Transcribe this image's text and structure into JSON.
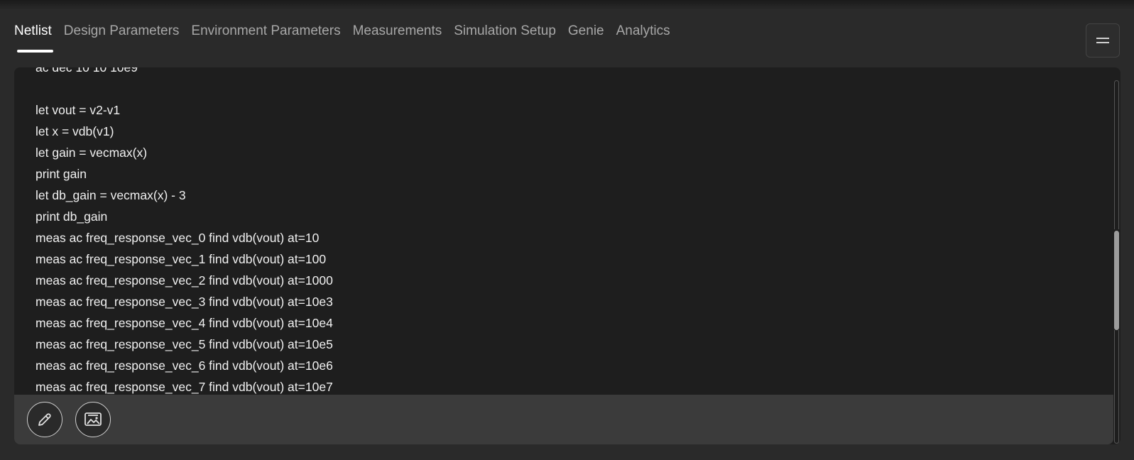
{
  "tabs": [
    {
      "label": "Netlist",
      "active": true
    },
    {
      "label": "Design Parameters"
    },
    {
      "label": "Environment Parameters"
    },
    {
      "label": "Measurements"
    },
    {
      "label": "Simulation Setup"
    },
    {
      "label": "Genie"
    },
    {
      "label": "Analytics"
    }
  ],
  "menu": {
    "icon": "hamburger-menu-icon"
  },
  "editor": {
    "lines": [
      "ac dec 10 10 10e9",
      "",
      "let vout = v2-v1",
      "let x = vdb(v1)",
      "let gain = vecmax(x)",
      "print gain",
      "let db_gain = vecmax(x) - 3",
      "print db_gain",
      "meas ac freq_response_vec_0 find vdb(vout) at=10",
      "meas ac freq_response_vec_1 find vdb(vout) at=100",
      "meas ac freq_response_vec_2 find vdb(vout) at=1000",
      "meas ac freq_response_vec_3 find vdb(vout) at=10e3",
      "meas ac freq_response_vec_4 find vdb(vout) at=10e4",
      "meas ac freq_response_vec_5 find vdb(vout) at=10e5",
      "meas ac freq_response_vec_6 find vdb(vout) at=10e6",
      "meas ac freq_response_vec_7 find vdb(vout) at=10e7"
    ]
  },
  "toolbar": {
    "edit_icon": "pencil-icon",
    "gallery_icon": "image-gallery-icon"
  },
  "colors": {
    "background": "#2a2a2a",
    "editor_bg": "#1e1e1e",
    "toolbar_bg": "#3b3b3b",
    "tab_inactive": "#a7a7a7",
    "tab_active": "#ffffff"
  }
}
